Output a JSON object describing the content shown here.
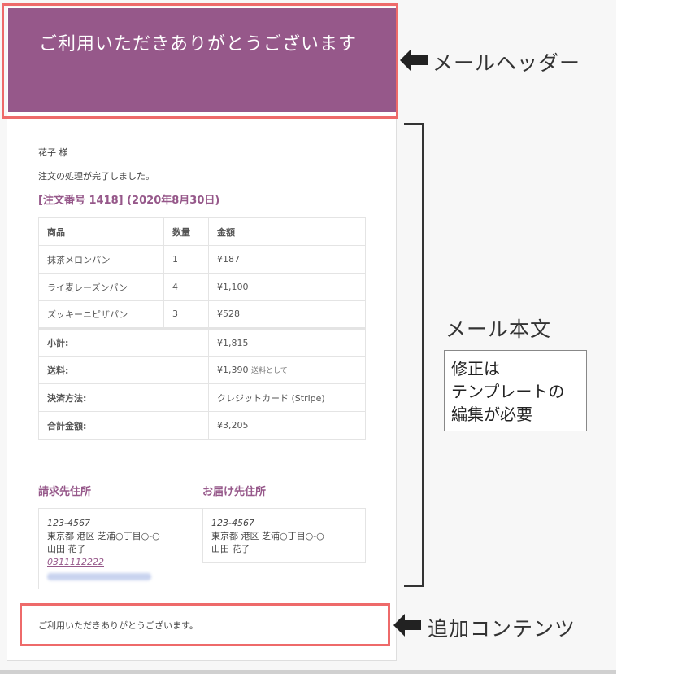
{
  "email": {
    "header_title": "ご利用いただきありがとうございます",
    "greeting": "花子 様",
    "intro": "注文の処理が完了しました。",
    "order_heading": "[注文番号 1418] (2020年8月30日)",
    "table": {
      "columns": [
        "商品",
        "数量",
        "金額"
      ],
      "items": [
        {
          "product": "抹茶メロンパン",
          "qty": "1",
          "price": "¥187"
        },
        {
          "product": "ライ麦レーズンパン",
          "qty": "4",
          "price": "¥1,100"
        },
        {
          "product": "ズッキーニピザパン",
          "qty": "3",
          "price": "¥528"
        }
      ],
      "totals": [
        {
          "label": "小計:",
          "value": "¥1,815",
          "note": ""
        },
        {
          "label": "送料:",
          "value": "¥1,390",
          "note": "送料として"
        },
        {
          "label": "決済方法:",
          "value": "クレジットカード (Stripe)",
          "note": ""
        },
        {
          "label": "合計金額:",
          "value": "¥3,205",
          "note": ""
        }
      ]
    },
    "billing": {
      "heading": "請求先住所",
      "postal": "123-4567",
      "address": "東京都 港区 芝浦○丁目○-○",
      "name": "山田 花子",
      "phone": "0311112222"
    },
    "shipping": {
      "heading": "お届け先住所",
      "postal": "123-4567",
      "address": "東京都 港区 芝浦○丁目○-○",
      "name": "山田 花子"
    },
    "additional_content": "ご利用いただきありがとうございます。"
  },
  "annotations": {
    "header_label": "メールヘッダー",
    "body_label": "メール本文",
    "note_lines": [
      "修正は",
      "テンプレートの",
      "編集が必要"
    ],
    "additional_label": "追加コンテンツ",
    "highlight_color": "#ee6a6a",
    "brand_color": "#96588a"
  }
}
